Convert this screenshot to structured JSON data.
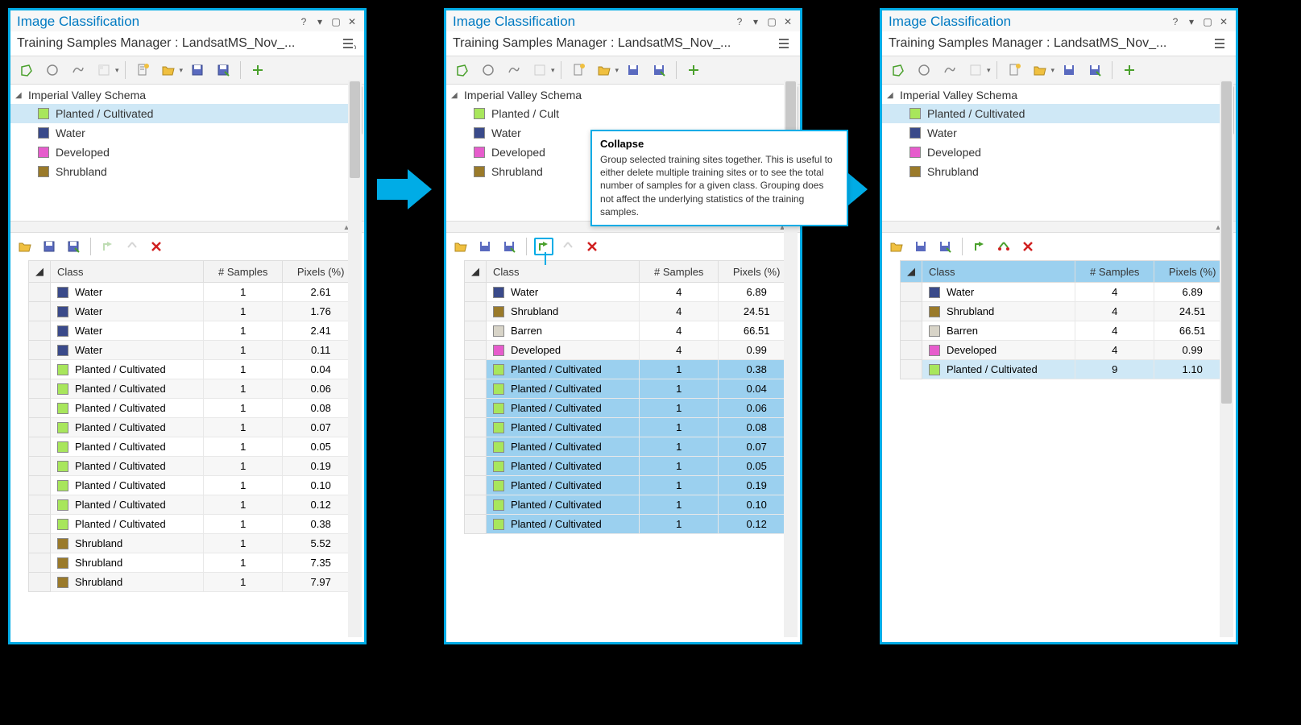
{
  "shared": {
    "title": "Image Classification",
    "subtitle": "Training Samples Manager : LandsatMS_Nov_...",
    "schema_root": "Imperial Valley Schema",
    "schema_items": [
      {
        "label": "Planted / Cultivated",
        "color": "#a8e65c",
        "selected": true
      },
      {
        "label": "Water",
        "color": "#3a4a8a",
        "selected": false
      },
      {
        "label": "Developed",
        "color": "#e65ccc",
        "selected": false
      },
      {
        "label": "Shrubland",
        "color": "#9a7a2a",
        "selected": false
      }
    ],
    "table_headers": {
      "class": "Class",
      "samples": "# Samples",
      "pixels": "Pixels (%)"
    },
    "tooltip": {
      "title": "Collapse",
      "body": "Group selected training sites together. This is useful to either delete multiple training sites or to see the total number of samples for a given class. Grouping does not affect the underlying statistics of the training samples."
    }
  },
  "panel1_rows": [
    {
      "class": "Water",
      "color": "#3a4a8a",
      "samples": 1,
      "pixels": "2.61"
    },
    {
      "class": "Water",
      "color": "#3a4a8a",
      "samples": 1,
      "pixels": "1.76"
    },
    {
      "class": "Water",
      "color": "#3a4a8a",
      "samples": 1,
      "pixels": "2.41"
    },
    {
      "class": "Water",
      "color": "#3a4a8a",
      "samples": 1,
      "pixels": "0.11"
    },
    {
      "class": "Planted / Cultivated",
      "color": "#a8e65c",
      "samples": 1,
      "pixels": "0.04"
    },
    {
      "class": "Planted / Cultivated",
      "color": "#a8e65c",
      "samples": 1,
      "pixels": "0.06"
    },
    {
      "class": "Planted / Cultivated",
      "color": "#a8e65c",
      "samples": 1,
      "pixels": "0.08"
    },
    {
      "class": "Planted / Cultivated",
      "color": "#a8e65c",
      "samples": 1,
      "pixels": "0.07"
    },
    {
      "class": "Planted / Cultivated",
      "color": "#a8e65c",
      "samples": 1,
      "pixels": "0.05"
    },
    {
      "class": "Planted / Cultivated",
      "color": "#a8e65c",
      "samples": 1,
      "pixels": "0.19"
    },
    {
      "class": "Planted / Cultivated",
      "color": "#a8e65c",
      "samples": 1,
      "pixels": "0.10"
    },
    {
      "class": "Planted / Cultivated",
      "color": "#a8e65c",
      "samples": 1,
      "pixels": "0.12"
    },
    {
      "class": "Planted / Cultivated",
      "color": "#a8e65c",
      "samples": 1,
      "pixels": "0.38"
    },
    {
      "class": "Shrubland",
      "color": "#9a7a2a",
      "samples": 1,
      "pixels": "5.52"
    },
    {
      "class": "Shrubland",
      "color": "#9a7a2a",
      "samples": 1,
      "pixels": "7.35"
    },
    {
      "class": "Shrubland",
      "color": "#9a7a2a",
      "samples": 1,
      "pixels": "7.97"
    }
  ],
  "panel2_rows": [
    {
      "class": "Water",
      "color": "#3a4a8a",
      "samples": 4,
      "pixels": "6.89",
      "sel": false
    },
    {
      "class": "Shrubland",
      "color": "#9a7a2a",
      "samples": 4,
      "pixels": "24.51",
      "sel": false
    },
    {
      "class": "Barren",
      "color": "#d8d4c8",
      "samples": 4,
      "pixels": "66.51",
      "sel": false
    },
    {
      "class": "Developed",
      "color": "#e65ccc",
      "samples": 4,
      "pixels": "0.99",
      "sel": false
    },
    {
      "class": "Planted / Cultivated",
      "color": "#a8e65c",
      "samples": 1,
      "pixels": "0.38",
      "sel": true
    },
    {
      "class": "Planted / Cultivated",
      "color": "#a8e65c",
      "samples": 1,
      "pixels": "0.04",
      "sel": true
    },
    {
      "class": "Planted / Cultivated",
      "color": "#a8e65c",
      "samples": 1,
      "pixels": "0.06",
      "sel": true
    },
    {
      "class": "Planted / Cultivated",
      "color": "#a8e65c",
      "samples": 1,
      "pixels": "0.08",
      "sel": true
    },
    {
      "class": "Planted / Cultivated",
      "color": "#a8e65c",
      "samples": 1,
      "pixels": "0.07",
      "sel": true
    },
    {
      "class": "Planted / Cultivated",
      "color": "#a8e65c",
      "samples": 1,
      "pixels": "0.05",
      "sel": true
    },
    {
      "class": "Planted / Cultivated",
      "color": "#a8e65c",
      "samples": 1,
      "pixels": "0.19",
      "sel": true
    },
    {
      "class": "Planted / Cultivated",
      "color": "#a8e65c",
      "samples": 1,
      "pixels": "0.10",
      "sel": true
    },
    {
      "class": "Planted / Cultivated",
      "color": "#a8e65c",
      "samples": 1,
      "pixels": "0.12",
      "sel": true
    }
  ],
  "panel3_rows": [
    {
      "class": "Water",
      "color": "#3a4a8a",
      "samples": 4,
      "pixels": "6.89",
      "hl": false
    },
    {
      "class": "Shrubland",
      "color": "#9a7a2a",
      "samples": 4,
      "pixels": "24.51",
      "hl": false
    },
    {
      "class": "Barren",
      "color": "#d8d4c8",
      "samples": 4,
      "pixels": "66.51",
      "hl": false
    },
    {
      "class": "Developed",
      "color": "#e65ccc",
      "samples": 4,
      "pixels": "0.99",
      "hl": false
    },
    {
      "class": "Planted / Cultivated",
      "color": "#a8e65c",
      "samples": 9,
      "pixels": "1.10",
      "hl": true
    }
  ]
}
